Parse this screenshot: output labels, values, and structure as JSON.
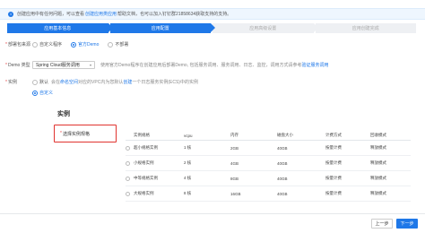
{
  "notice": {
    "text_before": "创建应用中有任何问题，可以查看",
    "link1": "创建应用类应用",
    "text_mid": "帮助文档，也可以加入钉钉群21858634获取支持的支持。"
  },
  "steps": [
    {
      "label": "应用基本信息",
      "state": "done"
    },
    {
      "label": "应用配置",
      "state": "active"
    },
    {
      "label": "应用高级设置",
      "state": "todo"
    },
    {
      "label": "应用创建完成",
      "state": "todo"
    }
  ],
  "source": {
    "label": "部署包来源",
    "options": [
      {
        "label": "自定义程序",
        "selected": false
      },
      {
        "label": "官方Demo",
        "selected": true
      },
      {
        "label": "不部署",
        "selected": false
      }
    ]
  },
  "demo_type": {
    "label": "Demo 类型",
    "value": "Spring Cloud服务调用",
    "hint_before": "使用官方Demo程序在创建应用后部署Demo, 包括服务调用、服务调用、日志、监控，调用方式请参考",
    "hint_link": "验证服务调用"
  },
  "instance": {
    "label": "实例",
    "options": [
      {
        "label": "默认",
        "selected": false
      },
      {
        "label": "自定义",
        "selected": true
      }
    ],
    "default_hint_before": "会在",
    "default_hint_link1": "命名空间",
    "default_hint_mid": "对应的VPC内为您默认",
    "default_hint_link2": "创建",
    "default_hint_end": "一个日志服务实例(ECS)中的实例"
  },
  "section_title": "实例",
  "spec_box": {
    "label": "选择实例规格"
  },
  "table": {
    "headers": [
      "实例规格",
      "vcpu",
      "内存",
      "磁盘大小",
      "计费方式",
      "回收模式"
    ],
    "rows": [
      [
        "超小规格实例",
        "1 核",
        "2GB",
        "40GB",
        "按量计费",
        "释放模式"
      ],
      [
        "小规格实例",
        "2 核",
        "4GB",
        "40GB",
        "按量计费",
        "释放模式"
      ],
      [
        "中等规格实例",
        "4 核",
        "8GB",
        "40GB",
        "按量计费",
        "释放模式"
      ],
      [
        "大规格实例",
        "8 核",
        "16GB",
        "40GB",
        "按量计费",
        "释放模式"
      ]
    ]
  },
  "footer": {
    "prev": "上一步",
    "next": "下一步"
  }
}
